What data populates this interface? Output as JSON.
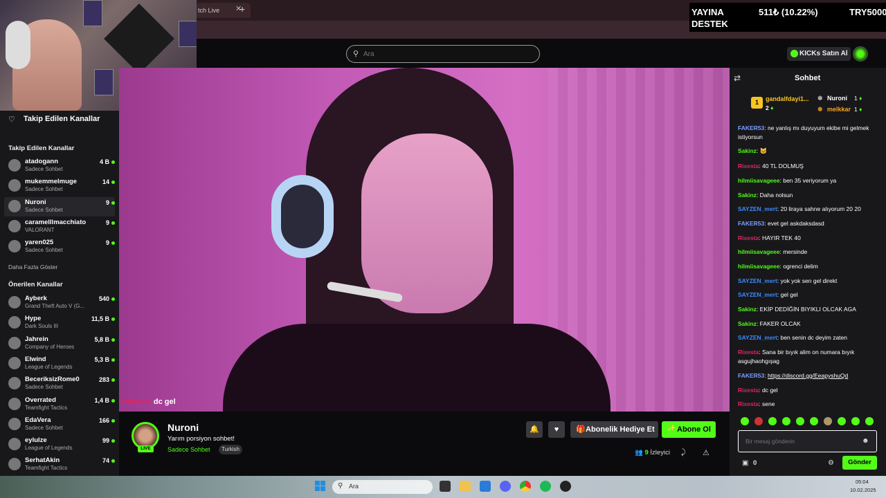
{
  "browser": {
    "tab_title": "tch Live",
    "tab_close": "✕",
    "new_tab": "+"
  },
  "overlay": {
    "line1": "YAYINA",
    "line2": "DESTEK",
    "amount": "511₺ (10.22%)",
    "goal": "TRY5000"
  },
  "header": {
    "search_placeholder": "Ara",
    "kicks_label": "KICKs Satın Al"
  },
  "sidebar": {
    "top_title": "Takip Edilen Kanallar",
    "followed_title": "Takip Edilen Kanallar",
    "show_more": "Daha Fazla Göster",
    "recommended_title": "Önerilen Kanallar",
    "followed": [
      {
        "name": "atadogann",
        "sub": "Sadece Sohbet",
        "viewers": "4 B"
      },
      {
        "name": "mukemmelmuge",
        "sub": "Sadece Sohbet",
        "viewers": "14"
      },
      {
        "name": "Nuroni",
        "sub": "Sadece Sohbet",
        "viewers": "9"
      },
      {
        "name": "caramelllmacchiato",
        "sub": "VALORANT",
        "viewers": "9"
      },
      {
        "name": "yaren025",
        "sub": "Sadece Sohbet",
        "viewers": "9"
      }
    ],
    "recommended": [
      {
        "name": "Ayberk",
        "sub": "Grand Theft Auto V (G...",
        "viewers": "540"
      },
      {
        "name": "Hype",
        "sub": "Dark Souls III",
        "viewers": "11,5 B"
      },
      {
        "name": "Jahrein",
        "sub": "Company of Heroes",
        "viewers": "5,8 B"
      },
      {
        "name": "Elwind",
        "sub": "League of Legends",
        "viewers": "5,3 B"
      },
      {
        "name": "BeceriksizRome0",
        "sub": "Sadece Sohbet",
        "viewers": "283"
      },
      {
        "name": "Overrated",
        "sub": "Teamfight Tactics",
        "viewers": "1,4 B"
      },
      {
        "name": "EdaVera",
        "sub": "Sadece Sohbet",
        "viewers": "166"
      },
      {
        "name": "eylulze",
        "sub": "League of Legends",
        "viewers": "99"
      },
      {
        "name": "SerhatAkin",
        "sub": "Teamfight Tactics",
        "viewers": "74"
      }
    ]
  },
  "video": {
    "caption_user": "Rixesta:",
    "caption_text": " dc gel"
  },
  "stream": {
    "streamer": "Nuroni",
    "live": "LIVE",
    "title": "Yarım porsiyon sohbet!",
    "category": "Sadece Sohbet",
    "language": "Turkish",
    "gift_label": "Abonelik Hediye Et",
    "subscribe_label": "Abone Ol",
    "viewer_count": "9",
    "viewer_label": "İzleyici"
  },
  "chat": {
    "title": "Sohbet",
    "pinned": [
      {
        "rank": "1",
        "name": "gandalfdayi1...",
        "value": "2"
      },
      {
        "name": "Nuroni",
        "value": "1"
      },
      {
        "name": "melkkar",
        "value": "1"
      }
    ],
    "messages": [
      {
        "user": "FAKER53",
        "color": "#7b9cff",
        "text": "ne yanlış mı duyuyum ekibe mi gelmek istiyorsun"
      },
      {
        "user": "Sakinz",
        "color": "#53fc18",
        "text": "🐱"
      },
      {
        "user": "Rixesta",
        "color": "#e0245e",
        "text": "40 TL DOLMUŞ"
      },
      {
        "user": "hilmiisavageee",
        "color": "#53fc18",
        "text": "ben 35 veriyorum ya"
      },
      {
        "user": "Sakinz",
        "color": "#53fc18",
        "text": "Daha nolsun"
      },
      {
        "user": "SAYZEN_mert",
        "color": "#3b8bff",
        "text": "20 liraya sahne alıyorum 20 20"
      },
      {
        "user": "FAKER53",
        "color": "#7b9cff",
        "text": "evet gel askdaksdasd"
      },
      {
        "user": "Rixesta",
        "color": "#e0245e",
        "text": "HAYIR TEK 40"
      },
      {
        "user": "hilmiisavageee",
        "color": "#53fc18",
        "text": "mersinde"
      },
      {
        "user": "hilmiisavageee",
        "color": "#53fc18",
        "text": "ogrenci delim"
      },
      {
        "user": "SAYZEN_mert",
        "color": "#3b8bff",
        "text": "yok yok sen gel direkt"
      },
      {
        "user": "SAYZEN_mert",
        "color": "#3b8bff",
        "text": "gel gel"
      },
      {
        "user": "Sakinz",
        "color": "#53fc18",
        "text": "EKİP DEDİĞİN BIYIKLI OLCAK AGA"
      },
      {
        "user": "Sakinz",
        "color": "#53fc18",
        "text": "FAKER OLCAK"
      },
      {
        "user": "SAYZEN_mert",
        "color": "#3b8bff",
        "text": "ben senin dc deyim zaten"
      },
      {
        "user": "Rixesta",
        "color": "#e0245e",
        "text": "Sana bir bıyık alim on numara bıyık asgujhaohgışag"
      },
      {
        "user": "FAKER53",
        "color": "#7b9cff",
        "text": "https://discord.gg/EeapyshuQd"
      },
      {
        "user": "Rixesta",
        "color": "#e0245e",
        "text": "dc gel"
      },
      {
        "user": "Rixesta",
        "color": "#e0245e",
        "text": "sene"
      }
    ],
    "input_placeholder": "Bir mesaj gönderin",
    "points": "0",
    "send_label": "Gönder"
  },
  "taskbar": {
    "search_placeholder": "Ara",
    "time": "05:04",
    "date": "10.02.2025"
  },
  "colors": {
    "accent": "#53fc18",
    "bg": "#0b0b0d",
    "panel": "#18181b"
  }
}
